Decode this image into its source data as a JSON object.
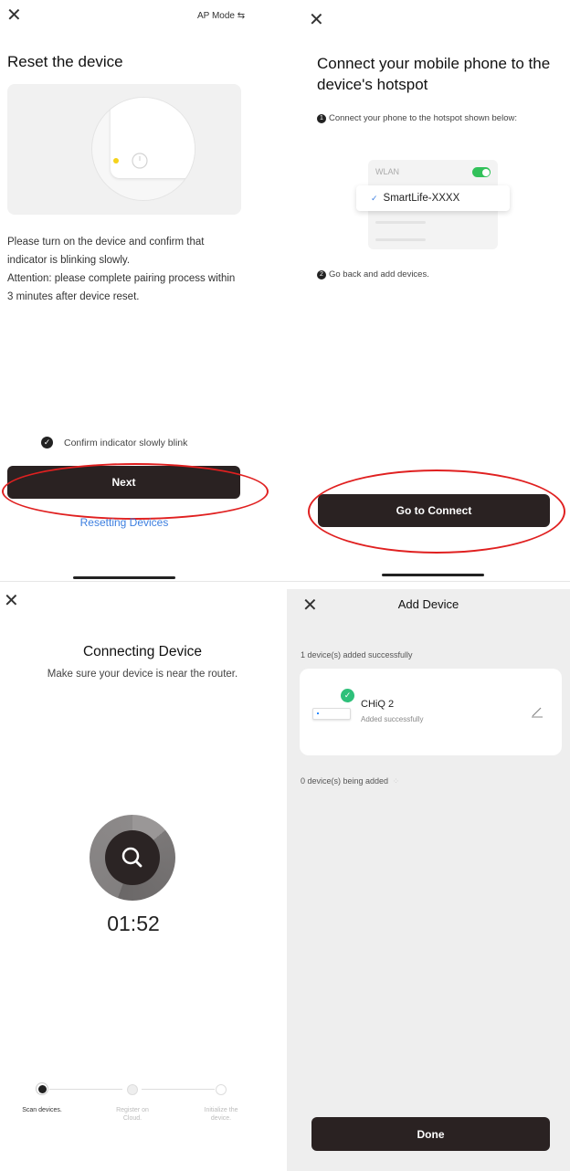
{
  "panel1": {
    "top_right_mode": "AP Mode ⇆",
    "title": "Reset the device",
    "body_line1": "Please turn on the device and confirm that indicator is blinking slowly.",
    "body_line2": "Attention: please complete pairing process within 3 minutes after device reset.",
    "confirm_label": "Confirm indicator slowly blink",
    "next_label": "Next",
    "resetting_link": "Resetting Devices"
  },
  "panel2": {
    "title": "Connect your mobile phone to the device's hotspot",
    "step1_num": "1",
    "step1_text": "Connect your phone to the hotspot shown below:",
    "wlan_label": "WLAN",
    "ssid_check": "✓",
    "ssid": "SmartLife-XXXX",
    "step2_num": "2",
    "step2_text": "Go back and add devices.",
    "connect_label": "Go to Connect"
  },
  "panel3": {
    "title": "Connecting Device",
    "subtitle": "Make sure your device is near the router.",
    "timer": "01:52",
    "steps": [
      {
        "label": "Scan devices.",
        "active": true
      },
      {
        "label": "Register on Cloud.",
        "active": false
      },
      {
        "label": "Initialize the device.",
        "active": false
      }
    ]
  },
  "panel4": {
    "title": "Add Device",
    "added_text": "1 device(s) added successfully",
    "device_name": "CHiQ 2",
    "device_status": "Added successfully",
    "adding_text": "0 device(s) being added",
    "done_label": "Done"
  },
  "colors": {
    "dark_button": "#2a2222",
    "link_blue": "#3d7fe0",
    "annotation_red": "#e02020",
    "success_green": "#2ec07a",
    "toggle_green": "#32c15a"
  },
  "icons": [
    "close-icon",
    "swap-icon",
    "power-icon",
    "check-icon",
    "search-icon",
    "edit-icon",
    "loading-icon"
  ]
}
